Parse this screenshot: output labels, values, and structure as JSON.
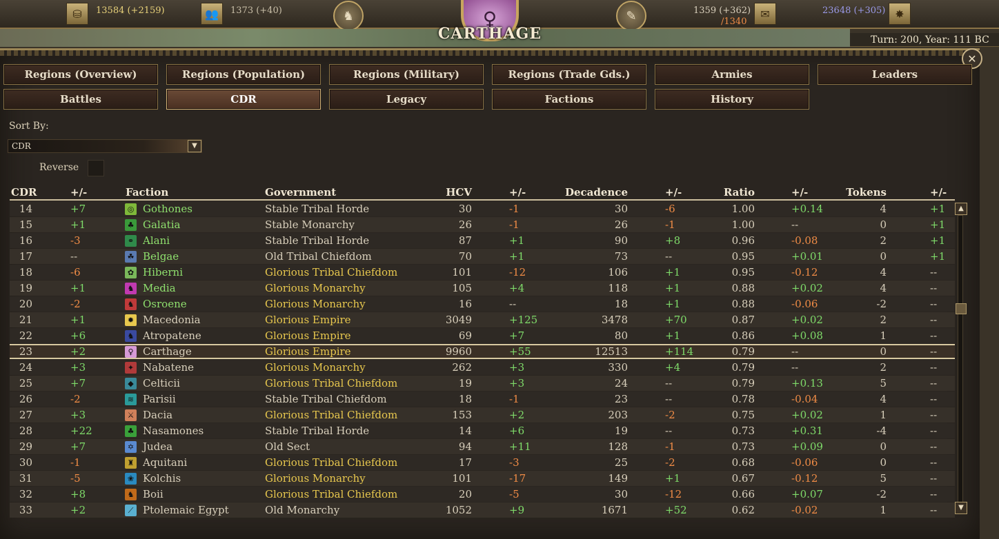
{
  "topbar": {
    "money": "13584 (+2159)",
    "population": "1373 (+40)",
    "manpower_current": "1359 (+362)",
    "manpower_cap": "/1340",
    "research": "23648 (+305)",
    "icons": [
      "coin-stack-icon",
      "population-icon",
      "warhorse-icon",
      "book-icon",
      "scroll-icon",
      "star-icon"
    ]
  },
  "faction_title": "Carthage",
  "turn_info": "Turn: 200, Year: 111 BC",
  "tabs_row1": [
    "Regions (Overview)",
    "Regions (Population)",
    "Regions (Military)",
    "Regions (Trade Gds.)",
    "Armies",
    "Leaders"
  ],
  "tabs_row2": [
    "Battles",
    "CDR",
    "Legacy",
    "Factions",
    "History"
  ],
  "active_tab": "CDR",
  "sort": {
    "label": "Sort By:",
    "value": "CDR",
    "reverse_label": "Reverse",
    "reverse_checked": false
  },
  "columns": [
    "CDR",
    "+/-",
    "Faction",
    "Government",
    "HCV",
    "+/-",
    "Decadence",
    "+/-",
    "Ratio",
    "+/-",
    "Tokens",
    "+/-"
  ],
  "colors": {
    "positive": "#7fdc6a",
    "negative": "#f08c46",
    "glorious": "#e8c84e",
    "friendly": "#8fe06e"
  },
  "rows": [
    {
      "cdr": "14",
      "cdr_d": "+7",
      "faction": "Gothones",
      "fc": "green",
      "icon": "#7fb83a",
      "glyph": "◎",
      "gov": "Stable Tribal Horde",
      "gc": "neu",
      "hcv": "30",
      "hcv_d": "-1",
      "dec": "30",
      "dec_d": "-6",
      "ratio": "1.00",
      "ratio_d": "+0.14",
      "tok": "4",
      "tok_d": "+1"
    },
    {
      "cdr": "15",
      "cdr_d": "+1",
      "faction": "Galatia",
      "fc": "green",
      "icon": "#3a9a3a",
      "glyph": "♣",
      "gov": "Stable Monarchy",
      "gc": "neu",
      "hcv": "26",
      "hcv_d": "-1",
      "dec": "26",
      "dec_d": "-1",
      "ratio": "1.00",
      "ratio_d": "--",
      "tok": "0",
      "tok_d": "+1"
    },
    {
      "cdr": "16",
      "cdr_d": "-3",
      "faction": "Alani",
      "fc": "green",
      "icon": "#2f8a4a",
      "glyph": "⚭",
      "gov": "Stable Tribal Horde",
      "gc": "neu",
      "hcv": "87",
      "hcv_d": "+1",
      "dec": "90",
      "dec_d": "+8",
      "ratio": "0.96",
      "ratio_d": "-0.08",
      "tok": "2",
      "tok_d": "+1"
    },
    {
      "cdr": "17",
      "cdr_d": "--",
      "faction": "Belgae",
      "fc": "green",
      "icon": "#5a7ab0",
      "glyph": "☘",
      "gov": "Old Tribal Chiefdom",
      "gc": "neu",
      "hcv": "70",
      "hcv_d": "+1",
      "dec": "73",
      "dec_d": "--",
      "ratio": "0.95",
      "ratio_d": "+0.01",
      "tok": "0",
      "tok_d": "+1"
    },
    {
      "cdr": "18",
      "cdr_d": "-6",
      "faction": "Hiberni",
      "fc": "green",
      "icon": "#7ab85a",
      "glyph": "✿",
      "gov": "Glorious Tribal Chiefdom",
      "gc": "gold",
      "hcv": "101",
      "hcv_d": "-12",
      "dec": "106",
      "dec_d": "+1",
      "ratio": "0.95",
      "ratio_d": "-0.12",
      "tok": "4",
      "tok_d": "--"
    },
    {
      "cdr": "19",
      "cdr_d": "+1",
      "faction": "Media",
      "fc": "green",
      "icon": "#c03ab0",
      "glyph": "♞",
      "gov": "Glorious Monarchy",
      "gc": "gold",
      "hcv": "105",
      "hcv_d": "+4",
      "dec": "118",
      "dec_d": "+1",
      "ratio": "0.88",
      "ratio_d": "+0.02",
      "tok": "4",
      "tok_d": "--"
    },
    {
      "cdr": "20",
      "cdr_d": "-2",
      "faction": "Osroene",
      "fc": "green",
      "icon": "#c03a3a",
      "glyph": "♞",
      "gov": "Glorious Monarchy",
      "gc": "gold",
      "hcv": "16",
      "hcv_d": "--",
      "dec": "18",
      "dec_d": "+1",
      "ratio": "0.88",
      "ratio_d": "-0.06",
      "tok": "-2",
      "tok_d": "--"
    },
    {
      "cdr": "21",
      "cdr_d": "+1",
      "faction": "Macedonia",
      "fc": "neu",
      "icon": "#e8c84e",
      "glyph": "✹",
      "gov": "Glorious Empire",
      "gc": "gold",
      "hcv": "3049",
      "hcv_d": "+125",
      "dec": "3478",
      "dec_d": "+70",
      "ratio": "0.87",
      "ratio_d": "+0.02",
      "tok": "2",
      "tok_d": "--"
    },
    {
      "cdr": "22",
      "cdr_d": "+6",
      "faction": "Atropatene",
      "fc": "neu",
      "icon": "#3a4aa0",
      "glyph": "♞",
      "gov": "Glorious Empire",
      "gc": "gold",
      "hcv": "69",
      "hcv_d": "+7",
      "dec": "80",
      "dec_d": "+1",
      "ratio": "0.86",
      "ratio_d": "+0.08",
      "tok": "1",
      "tok_d": "--"
    },
    {
      "cdr": "23",
      "cdr_d": "+2",
      "faction": "Carthage",
      "fc": "neu",
      "icon": "#d79ad7",
      "glyph": "♀",
      "gov": "Glorious Empire",
      "gc": "gold",
      "hcv": "9960",
      "hcv_d": "+55",
      "dec": "12513",
      "dec_d": "+114",
      "ratio": "0.79",
      "ratio_d": "--",
      "tok": "0",
      "tok_d": "--",
      "selected": true
    },
    {
      "cdr": "24",
      "cdr_d": "+3",
      "faction": "Nabatene",
      "fc": "neu",
      "icon": "#b03a3a",
      "glyph": "✦",
      "gov": "Glorious Monarchy",
      "gc": "gold",
      "hcv": "262",
      "hcv_d": "+3",
      "dec": "330",
      "dec_d": "+4",
      "ratio": "0.79",
      "ratio_d": "--",
      "tok": "2",
      "tok_d": "--"
    },
    {
      "cdr": "25",
      "cdr_d": "+7",
      "faction": "Celticii",
      "fc": "neu",
      "icon": "#3a8a9a",
      "glyph": "◆",
      "gov": "Glorious Tribal Chiefdom",
      "gc": "gold",
      "hcv": "19",
      "hcv_d": "+3",
      "dec": "24",
      "dec_d": "--",
      "ratio": "0.79",
      "ratio_d": "+0.13",
      "tok": "5",
      "tok_d": "--"
    },
    {
      "cdr": "26",
      "cdr_d": "-2",
      "faction": "Parisii",
      "fc": "neu",
      "icon": "#2a9a9a",
      "glyph": "≋",
      "gov": "Stable Tribal Chiefdom",
      "gc": "neu",
      "hcv": "18",
      "hcv_d": "-1",
      "dec": "23",
      "dec_d": "--",
      "ratio": "0.78",
      "ratio_d": "-0.04",
      "tok": "4",
      "tok_d": "--"
    },
    {
      "cdr": "27",
      "cdr_d": "+3",
      "faction": "Dacia",
      "fc": "neu",
      "icon": "#d0805a",
      "glyph": "⚔",
      "gov": "Glorious Tribal Chiefdom",
      "gc": "gold",
      "hcv": "153",
      "hcv_d": "+2",
      "dec": "203",
      "dec_d": "-2",
      "ratio": "0.75",
      "ratio_d": "+0.02",
      "tok": "1",
      "tok_d": "--"
    },
    {
      "cdr": "28",
      "cdr_d": "+22",
      "faction": "Nasamones",
      "fc": "neu",
      "icon": "#3aa03a",
      "glyph": "♣",
      "gov": "Stable Tribal Horde",
      "gc": "neu",
      "hcv": "14",
      "hcv_d": "+6",
      "dec": "19",
      "dec_d": "--",
      "ratio": "0.73",
      "ratio_d": "+0.31",
      "tok": "-4",
      "tok_d": "--"
    },
    {
      "cdr": "29",
      "cdr_d": "+7",
      "faction": "Judea",
      "fc": "neu",
      "icon": "#5a8ad0",
      "glyph": "✡",
      "gov": "Old Sect",
      "gc": "neu",
      "hcv": "94",
      "hcv_d": "+11",
      "dec": "128",
      "dec_d": "-1",
      "ratio": "0.73",
      "ratio_d": "+0.09",
      "tok": "0",
      "tok_d": "--"
    },
    {
      "cdr": "30",
      "cdr_d": "-1",
      "faction": "Aquitani",
      "fc": "neu",
      "icon": "#c0a030",
      "glyph": "♜",
      "gov": "Glorious Tribal Chiefdom",
      "gc": "gold",
      "hcv": "17",
      "hcv_d": "-3",
      "dec": "25",
      "dec_d": "-2",
      "ratio": "0.68",
      "ratio_d": "-0.06",
      "tok": "0",
      "tok_d": "--"
    },
    {
      "cdr": "31",
      "cdr_d": "-5",
      "faction": "Kolchis",
      "fc": "neu",
      "icon": "#2a8ac0",
      "glyph": "❀",
      "gov": "Glorious Monarchy",
      "gc": "gold",
      "hcv": "101",
      "hcv_d": "-17",
      "dec": "149",
      "dec_d": "+1",
      "ratio": "0.67",
      "ratio_d": "-0.12",
      "tok": "5",
      "tok_d": "--"
    },
    {
      "cdr": "32",
      "cdr_d": "+8",
      "faction": "Boii",
      "fc": "neu",
      "icon": "#c06a1a",
      "glyph": "♞",
      "gov": "Glorious Tribal Chiefdom",
      "gc": "gold",
      "hcv": "20",
      "hcv_d": "-5",
      "dec": "30",
      "dec_d": "-12",
      "ratio": "0.66",
      "ratio_d": "+0.07",
      "tok": "-2",
      "tok_d": "--"
    },
    {
      "cdr": "33",
      "cdr_d": "+2",
      "faction": "Ptolemaic Egypt",
      "fc": "neu",
      "icon": "#5ab0d0",
      "glyph": "⟋",
      "gov": "Old Monarchy",
      "gc": "neu",
      "hcv": "1052",
      "hcv_d": "+9",
      "dec": "1671",
      "dec_d": "+52",
      "ratio": "0.62",
      "ratio_d": "-0.02",
      "tok": "1",
      "tok_d": "--"
    }
  ]
}
